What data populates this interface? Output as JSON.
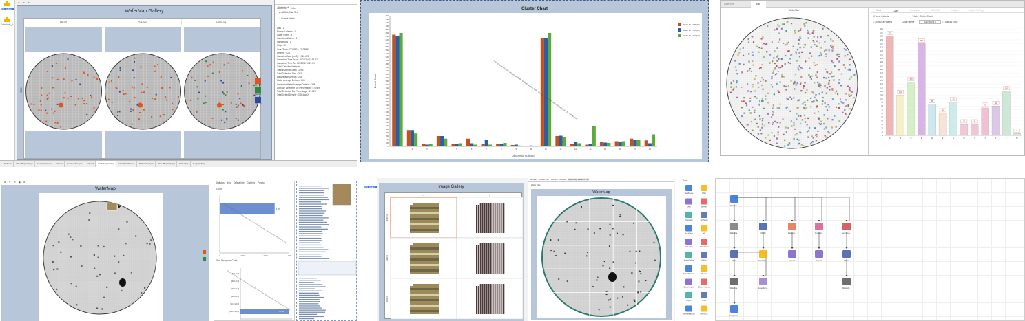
{
  "p1": {
    "title": "WaferMap Gallery",
    "side_label": "DataNode_2",
    "side_selected": "WM_Gallery",
    "slot_headers": [
      "Slot-09",
      "P01-020",
      "C0001-01"
    ],
    "ylabel": "C001",
    "legend": [
      {
        "label": "Scr1 Ch",
        "color": "#e0541e"
      },
      {
        "label": "P12 HR",
        "color": "#2c8a3c"
      },
      {
        "label": "HDP LO",
        "color": "#2d4aa3"
      }
    ],
    "props_tab1": "WaferInfo",
    "props_tab2": "Info",
    "props_title": "Statistics of:",
    "radio1": "All Sub Data Set",
    "radio2": "Current Wafer",
    "props_lines": [
      "Lots : 1",
      "Physical Wafers : 1",
      "Wafer Count : 3",
      "Inspected Wafers : 3",
      "Inspections : 3",
      "Steps : 3",
      "Scan Tools : PROBE1, PROBE2",
      "Defects : 624",
      "Inspected Area (cm2) : 1760.476",
      "Inspection Time From : 2023/2/4 11:57:57",
      "Inspection Time To : 2023/2/6 10:21:21",
      "Total Classified Defects : 1",
      "Total Inspected Dies : 2253",
      "Total Defective Dies : 362",
      "Lot Average Defects : 208",
      "Wafer Average Defects : 208",
      "Inspected Wafer Average Defects : 208",
      "Average Defective Die Percentage : 57.06%",
      "Total Defective Die Percentage : 57.06%",
      "Total Defect Density : 0.354/cm2"
    ],
    "bottom_tabs": [
      "DefSet1",
      "WaferMapGallery1",
      "ClusterAnalysis1",
      "Chart1",
      "RandomAnalysis1",
      "Chart2",
      "WaferMapGallery",
      "ClassDistribution1",
      "PaRetoAnalysis",
      "WaferMapGallery2",
      "WaferMap",
      "ImageGallery"
    ]
  },
  "p2": {
    "title": "Cluster Chart",
    "xlabel": "Dimension Cluster",
    "ylabel": "Defect Count",
    "watermark": "This is an evaluation version of Wafer Data Analytics Suite. Please register at www.company.com for full version",
    "chart_data": {
      "type": "bar",
      "title": "Cluster Chart",
      "xlabel": "Dimension Cluster",
      "ylabel": "Defect Count",
      "ylim": [
        0,
        760
      ],
      "categories": [
        "1",
        "2",
        "3",
        "4",
        "5",
        "6",
        "7",
        "8",
        "9",
        "10",
        "11",
        "12",
        "13",
        "14",
        "15",
        "16",
        "17",
        "18"
      ],
      "series": [
        {
          "name": "Wafer ID: 1028 (A1)",
          "color": "#c4511a",
          "values": [
            650,
            95,
            12,
            60,
            15,
            45,
            15,
            12,
            8,
            0,
            630,
            60,
            15,
            10,
            25,
            30,
            45,
            35
          ]
        },
        {
          "name": "Wafer ID: 1762 (A2)",
          "color": "#2c5ea5",
          "values": [
            640,
            95,
            10,
            60,
            12,
            18,
            40,
            15,
            10,
            5,
            630,
            62,
            25,
            12,
            22,
            25,
            40,
            18
          ]
        },
        {
          "name": "Wafer ID: 1447 (C1)",
          "color": "#5aaa3c",
          "values": [
            660,
            75,
            12,
            45,
            18,
            10,
            10,
            20,
            5,
            0,
            660,
            55,
            18,
            120,
            20,
            30,
            40,
            70
          ]
        }
      ]
    }
  },
  "p3": {
    "tab1": "WaferView",
    "tab2": "Map",
    "viewer_title": "WaferMap",
    "right_tabs": [
      "Stats",
      "Chart",
      "Summary",
      "WaferInfo",
      "Images",
      "Layout Settings"
    ],
    "filter_label1": "X Axis : Defects",
    "filter_label2": "Y Axis : Defect Count",
    "check1": "Select all wafers",
    "field_label": "Color Palette",
    "field_value": "RAINBOW 6",
    "check2": "Display Zone",
    "chart_data": {
      "type": "bar",
      "categories": [
        "A",
        "B",
        "C",
        "D",
        "E",
        "F",
        "G",
        "H",
        "I",
        "J",
        "K",
        "L",
        "M"
      ],
      "values": [
        270,
        110,
        145,
        250,
        85,
        60,
        90,
        30,
        30,
        75,
        80,
        120,
        5
      ],
      "labels": [
        "270",
        "110",
        "145",
        "250",
        "85",
        "60",
        "90",
        "30",
        "30",
        "75",
        "80",
        "120",
        "5"
      ],
      "colors": [
        "#f2b5b5",
        "#f5f0c5",
        "#d5f0c5",
        "#d9b5e5",
        "#cbe9ef",
        "#f8e4d4",
        "#cdebea",
        "#f0c8d6",
        "#f0c5d5",
        "#f2bfd4",
        "#dbc8e8",
        "#cde9d5",
        "#cde9d5"
      ],
      "ylim": [
        0,
        290
      ],
      "yticks": [
        "290",
        "280",
        "270",
        "260",
        "250",
        "240",
        "230",
        "220",
        "210",
        "200",
        "190",
        "180",
        "170",
        "160",
        "150",
        "140",
        "130",
        "120",
        "110",
        "100",
        "90",
        "80",
        "70",
        "60",
        "50",
        "40",
        "30",
        "20",
        "10",
        "0"
      ]
    }
  },
  "p4": {
    "title": "WaferMap",
    "legend": [
      {
        "label": "1",
        "color": "#e0541e"
      },
      {
        "label": "2",
        "color": "#2c8a3c"
      }
    ],
    "tabs": [
      "Statistics",
      "Info",
      "Defect Info",
      "Dist Info",
      "Pareto"
    ],
    "chart1_title": "Chart",
    "chart1_bar_label": "4,782",
    "chart2_title": "Size Histogram Chart",
    "chart2_cats": [
      "[0.0,20.0]",
      "[20.0,40.0]",
      "[40.0,60.0]",
      "[60.0,80.0]",
      "[80.0,100.0]",
      "[100.0,120.0]"
    ],
    "chart2_bar_label": "28,140",
    "chart_data": [
      {
        "type": "bar",
        "title": "Chart",
        "categories": [
          "1"
        ],
        "values": [
          4782
        ],
        "xticks": [
          "0",
          "2,000",
          "4,000",
          "6,000"
        ]
      },
      {
        "type": "bar",
        "title": "Size Histogram Chart",
        "categories": [
          "[0.0,20.0]",
          "[20.0,40.0]",
          "[40.0,60.0]",
          "[60.0,80.0]",
          "[80.0,100.0]",
          "[100.0,120.0]"
        ],
        "values": [
          0,
          0,
          0,
          0,
          0,
          28140
        ],
        "xticks": [
          "0",
          "10,000",
          "20,000",
          "30,000"
        ]
      }
    ]
  },
  "p5": {
    "side_selected": "DSS_Gallery",
    "gallery_title": "Image Gallery",
    "col_headers": [
      "1",
      "2"
    ],
    "row_headers": [
      "Defect1",
      "Defect2",
      "Defect3"
    ],
    "tabs": [
      "Statistics",
      "Defect Info",
      "Content",
      "Review",
      "WaferMap Statistics Info"
    ],
    "subtab": "Wafer Map",
    "wafer_title": "WaferMap"
  },
  "p6": {
    "tools_title": "Tools",
    "tools": [
      {
        "label": "DataSource",
        "icon": "database-icon"
      },
      {
        "label": "Filter",
        "icon": "filter-icon"
      },
      {
        "label": "Chart",
        "icon": "chart-icon"
      },
      {
        "label": "BarPlot",
        "icon": "barplot-icon"
      },
      {
        "label": "Histogram",
        "icon": "histogram-icon"
      },
      {
        "label": "TopPareto",
        "icon": "pareto-icon"
      },
      {
        "label": "StackChart",
        "icon": "stack-icon"
      },
      {
        "label": "DAT",
        "icon": "dat-icon"
      },
      {
        "label": "WaferMap",
        "icon": "wafermap-icon"
      },
      {
        "label": "WaferStack",
        "icon": "waferstack-icon"
      },
      {
        "label": "ImageGallery",
        "icon": "gallery-icon"
      },
      {
        "label": "DefSet",
        "icon": "defset-icon"
      },
      {
        "label": "DefectRandom",
        "icon": "defect-icon"
      },
      {
        "label": "KMeans",
        "icon": "kmeans-icon"
      },
      {
        "label": "ClassAnalysis",
        "icon": "class-icon"
      },
      {
        "label": "ClusterAnalysis",
        "icon": "cluster-icon"
      },
      {
        "label": "Export",
        "icon": "export-icon"
      },
      {
        "label": "Script",
        "icon": "script-icon"
      },
      {
        "label": "WaferMaskAnal",
        "icon": "mask-icon"
      },
      {
        "label": "DefectGal",
        "icon": "defectgal-icon"
      }
    ],
    "nodes": [
      "DataSou...",
      "WaferMa...",
      "DR2D",
      "Random...",
      "Clusterin...",
      "SamplingL...",
      "Filter1",
      "StackCha...",
      "Chart1",
      "Chart1",
      "Filter2",
      "WaferMa...",
      "SuperReco...",
      "WaferMa...",
      "ImageGal..."
    ]
  }
}
